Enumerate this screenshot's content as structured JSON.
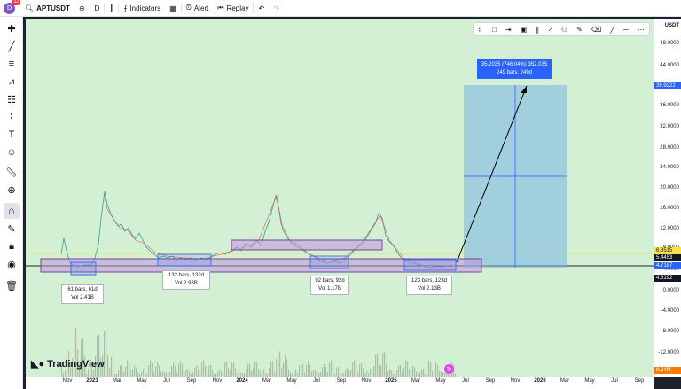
{
  "topbar": {
    "avatar": "D",
    "notifications": "32",
    "symbol": "APTUSDT",
    "interval": "D",
    "indicators": "Indicators",
    "alert": "Alert",
    "replay": "Replay"
  },
  "price_axis": {
    "currency": "USDT",
    "ticks": [
      "48.0000",
      "44.0000",
      "40.0000",
      "36.0000",
      "32.0000",
      "28.0000",
      "24.0000",
      "20.0000",
      "16.0000",
      "12.0000",
      "8.0000",
      "4.0000",
      "0.0000",
      "-4.0000",
      "-8.0000",
      "-12.0000"
    ],
    "badges": {
      "target": "39.9222",
      "yellow": "6.8515",
      "dark": "5.4453",
      "blue": "4.7187",
      "current": "4.6192",
      "volume": "9.64M"
    }
  },
  "time_axis": {
    "ticks": [
      "Nov",
      "2023",
      "Mar",
      "May",
      "Jul",
      "Sep",
      "Nov",
      "2024",
      "Mar",
      "May",
      "Jul",
      "Sep",
      "Nov",
      "2025",
      "Mar",
      "May",
      "Jul",
      "Sep",
      "Nov",
      "2026",
      "Mar",
      "May",
      "Jul",
      "Sep"
    ]
  },
  "measures": [
    {
      "line1": "61 bars, 61d",
      "line2": "Vol 2.41B"
    },
    {
      "line1": "132 bars, 132d",
      "line2": "Vol 2.93B"
    },
    {
      "line1": "92 bars, 92d",
      "line2": "Vol 1.17B"
    },
    {
      "line1": "123 bars, 123d",
      "line2": "Vol 2.13B"
    }
  ],
  "projection": {
    "line1": "35.2035 (746.04%) 352,035",
    "line2": "249 bars, 249d"
  },
  "brand": "TradingView",
  "colors": {
    "chart_bg": "#d4f0d4",
    "accent": "#2962ff",
    "box": "#be96dc"
  }
}
